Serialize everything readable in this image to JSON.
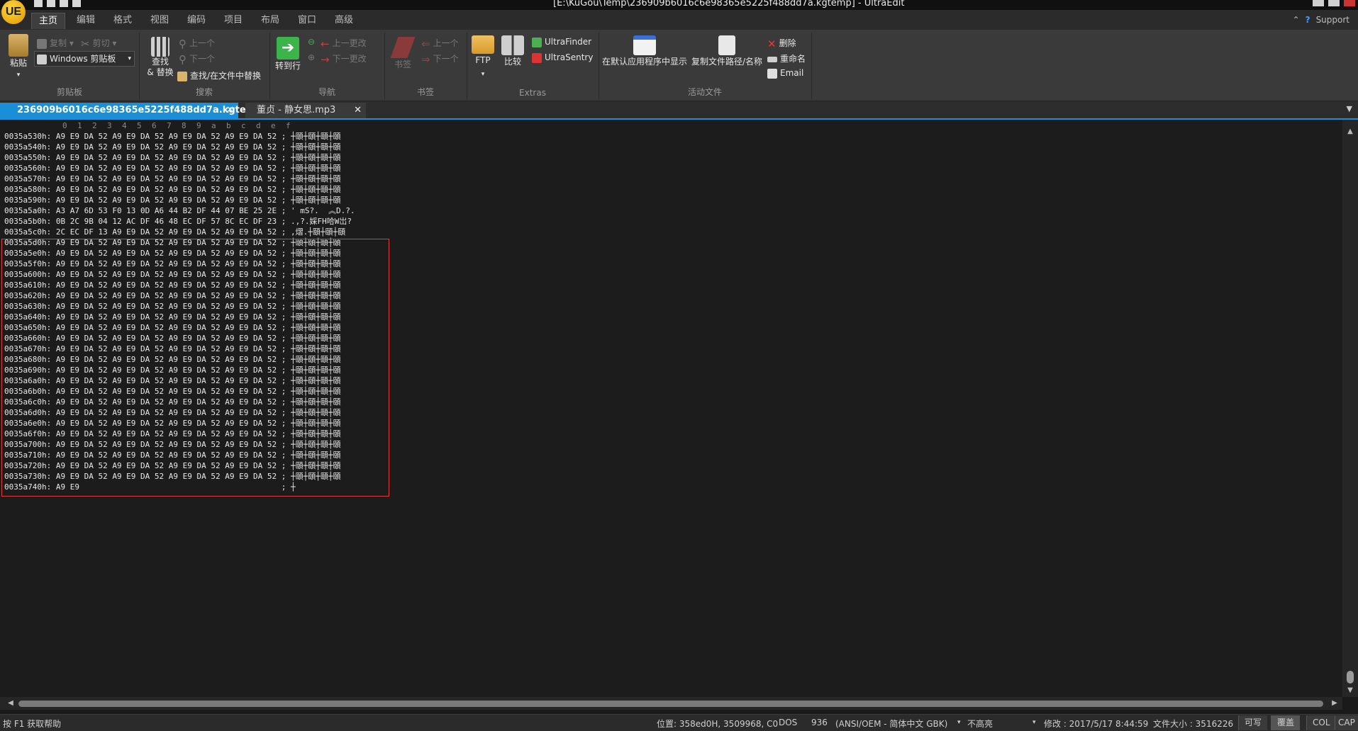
{
  "window": {
    "title": "[E:\\KuGou\\Temp\\236909b6016c6e98365e5225f488dd7a.kgtemp] - UltraEdit",
    "logo_text": "UE"
  },
  "menu": {
    "tabs": [
      "主页",
      "编辑",
      "格式",
      "视图",
      "编码",
      "项目",
      "布局",
      "窗口",
      "高级"
    ],
    "active_index": 0,
    "support_label": "Support"
  },
  "ribbon": {
    "clipboard": {
      "paste": "粘贴",
      "copy": "复制",
      "cut": "剪切",
      "clipboard_select": "Windows 剪贴板",
      "group_label": "剪贴板"
    },
    "search": {
      "find_replace_line1": "查找",
      "find_replace_line2": "& 替换",
      "prev": "上一个",
      "next": "下一个",
      "find_in_files": "查找/在文件中替换",
      "group_label": "搜索"
    },
    "navigation": {
      "goto_line": "转到行",
      "prev_change": "上一更改",
      "next_change": "下一更改",
      "group_label": "导航"
    },
    "bookmarks": {
      "bookmark": "书签",
      "prev": "上一个",
      "next": "下一个",
      "group_label": "书签"
    },
    "extras": {
      "ftp": "FTP",
      "compare": "比较",
      "ultrafinder": "UltraFinder",
      "ultrasentry": "UltraSentry",
      "group_label": "Extras"
    },
    "active_file": {
      "show_default_app": "在默认应用程序中显示",
      "copy_path": "复制文件路径/名称",
      "delete": "删除",
      "rename": "重命名",
      "email": "Email",
      "group_label": "活动文件"
    }
  },
  "tabs": [
    {
      "label": "236909b6016c6e98365e5225f488dd7a.kgtemp",
      "active": true
    },
    {
      "label": "董贞 - 静女思.mp3",
      "active": false
    }
  ],
  "editor": {
    "ruler": [
      "0",
      "1",
      "2",
      "3",
      "4",
      "5",
      "6",
      "7",
      "8",
      "9",
      "a",
      "b",
      "c",
      "d",
      "e",
      "f"
    ],
    "lines": [
      "0035a530h: A9 E9 DA 52 A9 E9 DA 52 A9 E9 DA 52 A9 E9 DA 52 ; ┼頤┼頤┼頤┼頤",
      "0035a540h: A9 E9 DA 52 A9 E9 DA 52 A9 E9 DA 52 A9 E9 DA 52 ; ┼頤┼頤┼頤┼頤",
      "0035a550h: A9 E9 DA 52 A9 E9 DA 52 A9 E9 DA 52 A9 E9 DA 52 ; ┼頤┼頤┼頤┼頤",
      "0035a560h: A9 E9 DA 52 A9 E9 DA 52 A9 E9 DA 52 A9 E9 DA 52 ; ┼頤┼頤┼頤┼頤",
      "0035a570h: A9 E9 DA 52 A9 E9 DA 52 A9 E9 DA 52 A9 E9 DA 52 ; ┼頤┼頤┼頤┼頤",
      "0035a580h: A9 E9 DA 52 A9 E9 DA 52 A9 E9 DA 52 A9 E9 DA 52 ; ┼頤┼頤┼頤┼頤",
      "0035a590h: A9 E9 DA 52 A9 E9 DA 52 A9 E9 DA 52 A9 E9 DA 52 ; ┼頤┼頤┼頤┼頤",
      "0035a5a0h: A3 A7 6D 53 F0 13 0D A6 44 B2 DF 44 07 BE 25 2E ; ' mS?.  ︽D.?.",
      "0035a5b0h: 0B 2C 9B 04 12 AC DF 46 48 EC DF 57 8C EC DF 23 ; .,?.婇FH哈W岀?",
      "0035a5c0h: 2C EC DF 13 A9 E9 DA 52 A9 E9 DA 52 A9 E9 DA 52 ; ,熠.┼頤┼頤┼頤",
      "0035a5d0h: A9 E9 DA 52 A9 E9 DA 52 A9 E9 DA 52 A9 E9 DA 52 ; ┼頤┼頤┼頤┼頤",
      "0035a5e0h: A9 E9 DA 52 A9 E9 DA 52 A9 E9 DA 52 A9 E9 DA 52 ; ┼頤┼頤┼頤┼頤",
      "0035a5f0h: A9 E9 DA 52 A9 E9 DA 52 A9 E9 DA 52 A9 E9 DA 52 ; ┼頤┼頤┼頤┼頤",
      "0035a600h: A9 E9 DA 52 A9 E9 DA 52 A9 E9 DA 52 A9 E9 DA 52 ; ┼頤┼頤┼頤┼頤",
      "0035a610h: A9 E9 DA 52 A9 E9 DA 52 A9 E9 DA 52 A9 E9 DA 52 ; ┼頤┼頤┼頤┼頤",
      "0035a620h: A9 E9 DA 52 A9 E9 DA 52 A9 E9 DA 52 A9 E9 DA 52 ; ┼頤┼頤┼頤┼頤",
      "0035a630h: A9 E9 DA 52 A9 E9 DA 52 A9 E9 DA 52 A9 E9 DA 52 ; ┼頤┼頤┼頤┼頤",
      "0035a640h: A9 E9 DA 52 A9 E9 DA 52 A9 E9 DA 52 A9 E9 DA 52 ; ┼頤┼頤┼頤┼頤",
      "0035a650h: A9 E9 DA 52 A9 E9 DA 52 A9 E9 DA 52 A9 E9 DA 52 ; ┼頤┼頤┼頤┼頤",
      "0035a660h: A9 E9 DA 52 A9 E9 DA 52 A9 E9 DA 52 A9 E9 DA 52 ; ┼頤┼頤┼頤┼頤",
      "0035a670h: A9 E9 DA 52 A9 E9 DA 52 A9 E9 DA 52 A9 E9 DA 52 ; ┼頤┼頤┼頤┼頤",
      "0035a680h: A9 E9 DA 52 A9 E9 DA 52 A9 E9 DA 52 A9 E9 DA 52 ; ┼頤┼頤┼頤┼頤",
      "0035a690h: A9 E9 DA 52 A9 E9 DA 52 A9 E9 DA 52 A9 E9 DA 52 ; ┼頤┼頤┼頤┼頤",
      "0035a6a0h: A9 E9 DA 52 A9 E9 DA 52 A9 E9 DA 52 A9 E9 DA 52 ; ┼頤┼頤┼頤┼頤",
      "0035a6b0h: A9 E9 DA 52 A9 E9 DA 52 A9 E9 DA 52 A9 E9 DA 52 ; ┼頤┼頤┼頤┼頤",
      "0035a6c0h: A9 E9 DA 52 A9 E9 DA 52 A9 E9 DA 52 A9 E9 DA 52 ; ┼頤┼頤┼頤┼頤",
      "0035a6d0h: A9 E9 DA 52 A9 E9 DA 52 A9 E9 DA 52 A9 E9 DA 52 ; ┼頤┼頤┼頤┼頤",
      "0035a6e0h: A9 E9 DA 52 A9 E9 DA 52 A9 E9 DA 52 A9 E9 DA 52 ; ┼頤┼頤┼頤┼頤",
      "0035a6f0h: A9 E9 DA 52 A9 E9 DA 52 A9 E9 DA 52 A9 E9 DA 52 ; ┼頤┼頤┼頤┼頤",
      "0035a700h: A9 E9 DA 52 A9 E9 DA 52 A9 E9 DA 52 A9 E9 DA 52 ; ┼頤┼頤┼頤┼頤",
      "0035a710h: A9 E9 DA 52 A9 E9 DA 52 A9 E9 DA 52 A9 E9 DA 52 ; ┼頤┼頤┼頤┼頤",
      "0035a720h: A9 E9 DA 52 A9 E9 DA 52 A9 E9 DA 52 A9 E9 DA 52 ; ┼頤┼頤┼頤┼頤",
      "0035a730h: A9 E9 DA 52 A9 E9 DA 52 A9 E9 DA 52 A9 E9 DA 52 ; ┼頤┼頤┼頤┼頤",
      "0035a740h: A9 E9                                           ; ┼"
    ]
  },
  "statusbar": {
    "help": "按 F1 获取帮助",
    "position": "位置: 358ed0H, 3509968, C0",
    "line_ending": "DOS",
    "codepage": "936",
    "encoding": "(ANSI/OEM - 简体中文 GBK)",
    "highlight": "不高亮",
    "modified": "修改 : 2017/5/17 8:44:59",
    "file_size": "文件大小 : 3516226",
    "writable": "可写",
    "overwrite": "覆盖",
    "col": "COL",
    "cap": "CAP"
  },
  "colors": {
    "accent": "#1a8fd8",
    "selection_border": "#e23b3b"
  }
}
